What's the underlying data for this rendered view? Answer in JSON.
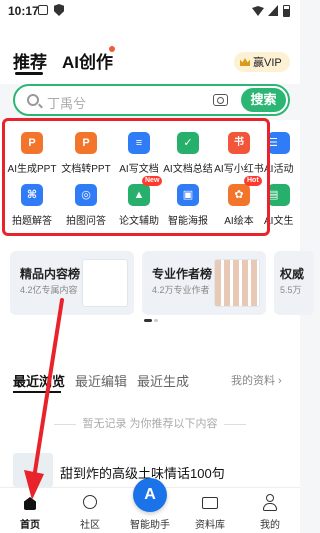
{
  "status_bar": {
    "time": "10:17"
  },
  "header": {
    "tab_recommend": "推荐",
    "tab_ai_create": "AI创作",
    "vip_label": "赢VIP"
  },
  "search": {
    "placeholder": "丁禹兮",
    "button": "搜索"
  },
  "tools": [
    {
      "label": "AI生成PPT",
      "icon": "ppt-icon",
      "color": "#f3752b",
      "glyph": "P"
    },
    {
      "label": "文档转PPT",
      "icon": "doc-to-ppt-icon",
      "color": "#f3752b",
      "glyph": "P"
    },
    {
      "label": "AI写文档",
      "icon": "write-doc-icon",
      "color": "#2f7cf6",
      "glyph": "≡"
    },
    {
      "label": "AI文档总结",
      "icon": "doc-summary-icon",
      "color": "#27b06b",
      "glyph": "✓"
    },
    {
      "label": "AI写小红书",
      "icon": "xiaohongshu-icon",
      "color": "#f2563a",
      "glyph": "书"
    },
    {
      "label": "AI活动",
      "icon": "activity-icon",
      "color": "#2f7cf6",
      "glyph": "☰"
    },
    {
      "label": "拍题解答",
      "icon": "photo-question-icon",
      "color": "#2f7cf6",
      "glyph": "⌘"
    },
    {
      "label": "拍图问答",
      "icon": "photo-qa-icon",
      "color": "#2f7cf6",
      "glyph": "◎"
    },
    {
      "label": "论文辅助",
      "icon": "thesis-icon",
      "color": "#27b06b",
      "glyph": "▲",
      "badge": "New"
    },
    {
      "label": "智能海报",
      "icon": "poster-icon",
      "color": "#2f7cf6",
      "glyph": "▣"
    },
    {
      "label": "AI绘本",
      "icon": "picture-book-icon",
      "color": "#f3752b",
      "glyph": "✿",
      "badge": "Hot"
    },
    {
      "label": "AI文生",
      "icon": "text-gen-icon",
      "color": "#27b06b",
      "glyph": "▤"
    }
  ],
  "cards": [
    {
      "title": "精品内容榜",
      "subtitle": "4.2亿专属内容"
    },
    {
      "title": "专业作者榜",
      "subtitle": "4.2万专业作者"
    },
    {
      "title": "权威",
      "subtitle": "5.5万"
    }
  ],
  "recent": {
    "tabs": [
      "最近浏览",
      "最近编辑",
      "最近生成"
    ],
    "my_docs": "我的资料 ›",
    "empty_text": "暂无记录 为你推荐以下内容",
    "item_title": "甜到炸的高级土味情话100句"
  },
  "nav": [
    "首页",
    "社区",
    "智能助手",
    "资料库",
    "我的"
  ],
  "colors": {
    "accent": "#2bb673",
    "highlight": "#e8232b",
    "assistant": "#1a73e8"
  }
}
